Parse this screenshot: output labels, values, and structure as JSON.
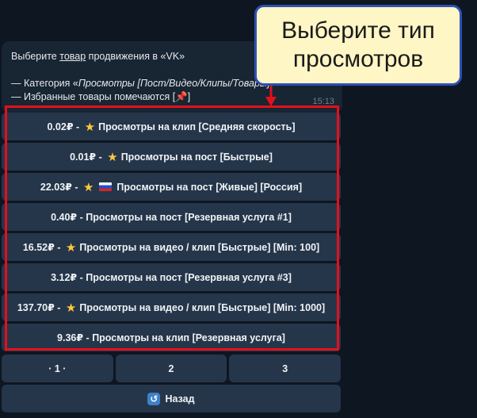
{
  "message": {
    "line1_prefix": "Выберите ",
    "line1_link": "товар",
    "line1_suffix": " продвижения в «VK»",
    "line3_prefix": "— Категория «",
    "line3_italic": "Просмотры [Пост/Видео/Клипы/Товары]",
    "line4_text": "— Избранные товары помечаются [",
    "line4_pin": "📌",
    "line4_end": "]",
    "time": "15:13"
  },
  "buttons": [
    {
      "price": "0.02₽",
      "sep": " - ",
      "star": true,
      "flag": false,
      "label": "Просмотры на клип [Средняя скорость]"
    },
    {
      "price": "0.01₽",
      "sep": " - ",
      "star": true,
      "flag": false,
      "label": "Просмотры на пост [Быстрые]"
    },
    {
      "price": "22.03₽",
      "sep": " - ",
      "star": true,
      "flag": true,
      "label": "Просмотры на пост [Живые] [Россия]"
    },
    {
      "price": "0.40₽",
      "sep": " - ",
      "star": false,
      "flag": false,
      "label": "Просмотры на пост [Резервная услуга #1]"
    },
    {
      "price": "16.52₽",
      "sep": " - ",
      "star": true,
      "flag": false,
      "label": "Просмотры на видео / клип [Быстрые] [Min: 100]"
    },
    {
      "price": "3.12₽",
      "sep": " - ",
      "star": false,
      "flag": false,
      "label": "Просмотры на пост [Резервная услуга #3]"
    },
    {
      "price": "137.70₽",
      "sep": " - ",
      "star": true,
      "flag": false,
      "label": "Просмотры на видео / клип [Быстрые] [Min: 1000]"
    },
    {
      "price": "9.36₽",
      "sep": " - ",
      "star": false,
      "flag": false,
      "label": "Просмотры на клип [Резервная услуга]"
    }
  ],
  "pagination": [
    "· 1 ·",
    "2",
    "3"
  ],
  "back_label": "Назад",
  "callout": {
    "line1": "Выберите тип",
    "line2": "просмотров"
  },
  "colors": {
    "highlight": "#e3101c",
    "callout_bg": "#fef6c4",
    "callout_border": "#2f4fb6"
  }
}
